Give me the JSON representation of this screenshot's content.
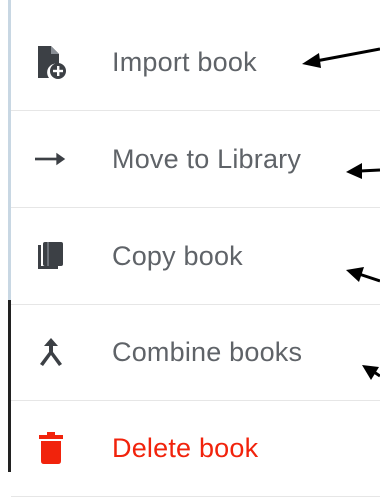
{
  "menu": {
    "items": [
      {
        "label": "Import book",
        "icon": "import-book-icon"
      },
      {
        "label": "Move to Library",
        "icon": "arrow-right-icon"
      },
      {
        "label": "Copy book",
        "icon": "copy-book-icon"
      },
      {
        "label": "Combine books",
        "icon": "merge-icon"
      },
      {
        "label": "Delete book",
        "icon": "trash-icon",
        "color": "#f1230c"
      }
    ]
  },
  "annotation_arrows": {
    "count": 4,
    "color": "#000000"
  }
}
